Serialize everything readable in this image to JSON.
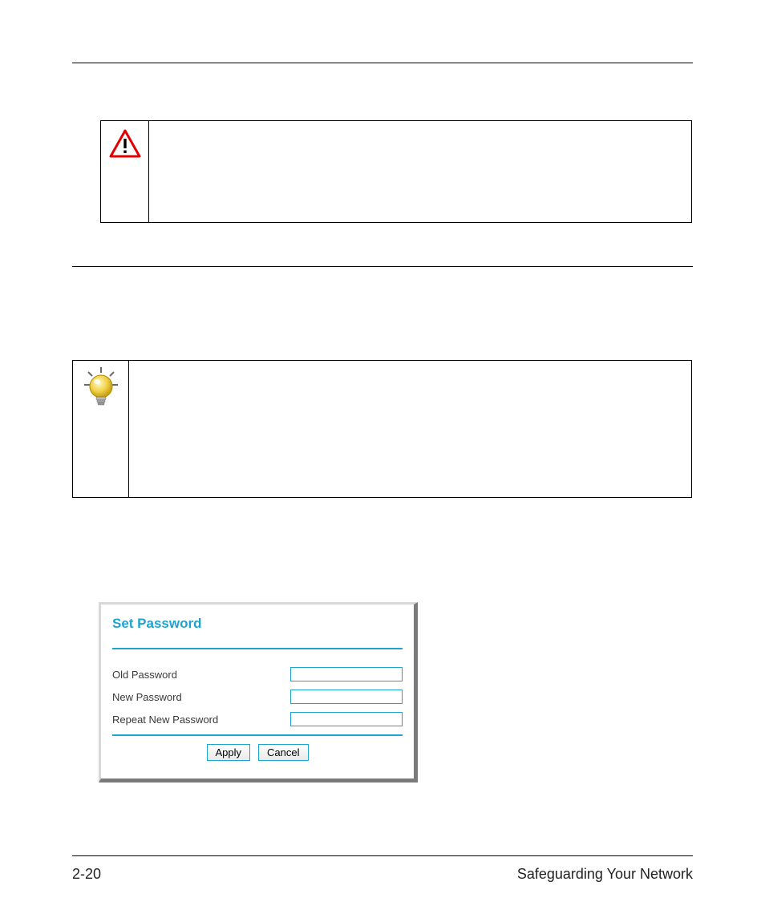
{
  "panel": {
    "title": "Set Password",
    "fields": {
      "old": {
        "label": "Old Password",
        "value": ""
      },
      "new": {
        "label": "New Password",
        "value": ""
      },
      "repeat": {
        "label": "Repeat New Password",
        "value": ""
      }
    },
    "buttons": {
      "apply": "Apply",
      "cancel": "Cancel"
    }
  },
  "footer": {
    "page_number": "2-20",
    "section_title": "Safeguarding Your Network"
  }
}
